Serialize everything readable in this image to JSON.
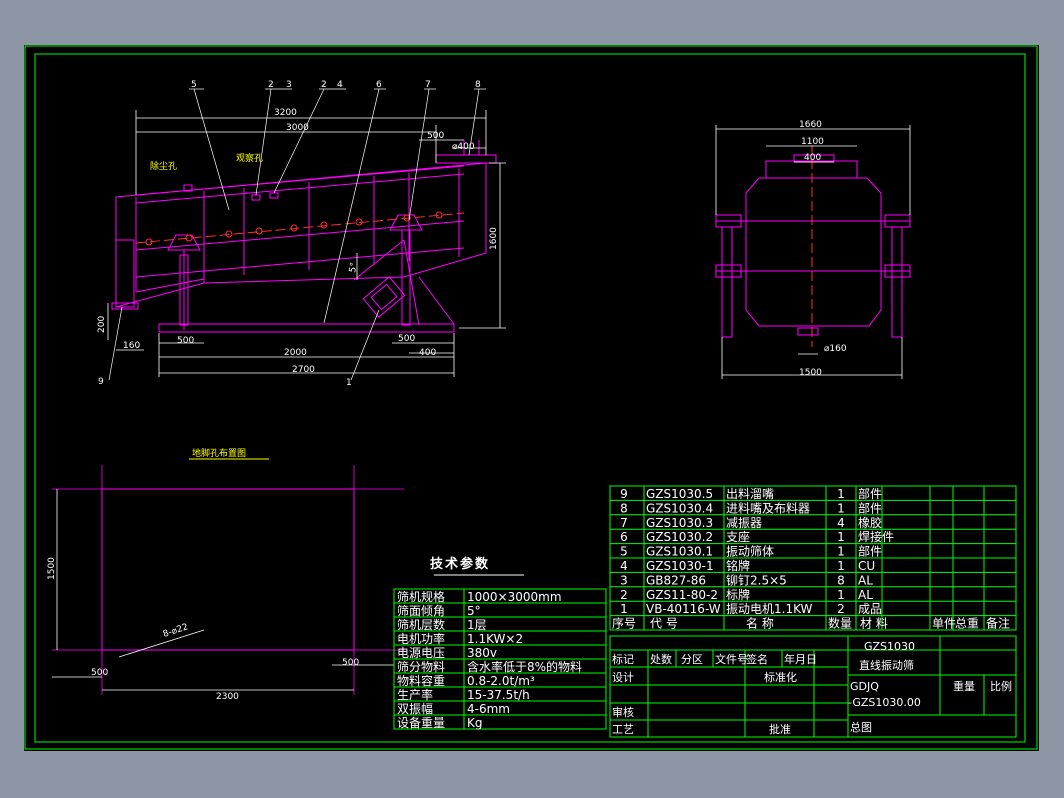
{
  "colors": {
    "frame": "#00ff00",
    "part": "#ff00ff",
    "dim": "#ffffff",
    "center": "#ff3030",
    "label": "#ffff00",
    "bg": "#000000"
  },
  "side_view": {
    "balloons": [
      "5",
      "2",
      "3",
      "2",
      "4",
      "6",
      "7",
      "8",
      "9",
      "1"
    ],
    "dims": {
      "d3200": "3200",
      "d3000": "3000",
      "d500a": "500",
      "d400a": "⌀400",
      "d1600": "1600",
      "d200": "200",
      "d160": "160",
      "d500b": "500",
      "d2000": "2000",
      "d500c": "500",
      "d400b": "400",
      "d2700": "2700",
      "d5deg": "5°"
    },
    "notes": {
      "dust": "除尘孔",
      "observe": "观察孔"
    }
  },
  "end_view": {
    "dims": {
      "d1660": "1660",
      "d1100": "1100",
      "d400": "400",
      "d160": "⌀160",
      "d1500": "1500"
    }
  },
  "foundation": {
    "title": "地脚孔布置图",
    "dims": {
      "d1500": "1500",
      "hole": "8-⌀22",
      "d500a": "500",
      "d500b": "500",
      "d2300": "2300"
    }
  },
  "tech": {
    "title": "技术参数",
    "rows": [
      {
        "k": "筛机规格",
        "v": "1000×3000mm"
      },
      {
        "k": "筛面倾角",
        "v": "5°"
      },
      {
        "k": "筛机层数",
        "v": "1层"
      },
      {
        "k": "电机功率",
        "v": "1.1KW×2"
      },
      {
        "k": "电源电压",
        "v": "380v"
      },
      {
        "k": "筛分物料",
        "v": "含水率低于8%的物料"
      },
      {
        "k": "物料容重",
        "v": "0.8-2.0t/m³"
      },
      {
        "k": "生产率",
        "v": "15-37.5t/h"
      },
      {
        "k": "双振幅",
        "v": "4-6mm"
      },
      {
        "k": "设备重量",
        "v": "Kg"
      }
    ]
  },
  "bom": {
    "rows": [
      {
        "no": "9",
        "code": "GZS1030.5",
        "name": "出料溜嘴",
        "qty": "1",
        "mat": "部件"
      },
      {
        "no": "8",
        "code": "GZS1030.4",
        "name": "进料嘴及布料器",
        "qty": "1",
        "mat": "部件"
      },
      {
        "no": "7",
        "code": "GZS1030.3",
        "name": "减振器",
        "qty": "4",
        "mat": "橡胶"
      },
      {
        "no": "6",
        "code": "GZS1030.2",
        "name": "支座",
        "qty": "1",
        "mat": "焊接件"
      },
      {
        "no": "5",
        "code": "GZS1030.1",
        "name": "振动筛体",
        "qty": "1",
        "mat": "部件"
      },
      {
        "no": "4",
        "code": "GZS1030-1",
        "name": "铭牌",
        "qty": "1",
        "mat": "CU"
      },
      {
        "no": "3",
        "code": "GB827-86",
        "name": "铆钉2.5×5",
        "qty": "8",
        "mat": "AL"
      },
      {
        "no": "2",
        "code": "GZS11-80-2",
        "name": "标牌",
        "qty": "1",
        "mat": "AL"
      },
      {
        "no": "1",
        "code": "VB-40116-W",
        "name": "振动电机1.1KW",
        "qty": "2",
        "mat": "成品"
      }
    ],
    "header": {
      "no": "序号",
      "code": "代  号",
      "name": "名   称",
      "qty": "数量",
      "mat": "材  料",
      "w1": "单件",
      "w2": "总重",
      "rem": "备注"
    }
  },
  "title_block": {
    "marks": [
      "标记",
      "处数",
      "分区",
      "文件号",
      "签名",
      "年月日"
    ],
    "design": "设计",
    "std": "标准化",
    "check": "审核",
    "craft": "工艺",
    "approve": "批准",
    "model": "GZS1030",
    "name": "直线振动筛",
    "company": "GDJQ",
    "drawing_no": "-GZS1030.00",
    "weight": "重量",
    "scale": "比例",
    "general": "总图"
  }
}
